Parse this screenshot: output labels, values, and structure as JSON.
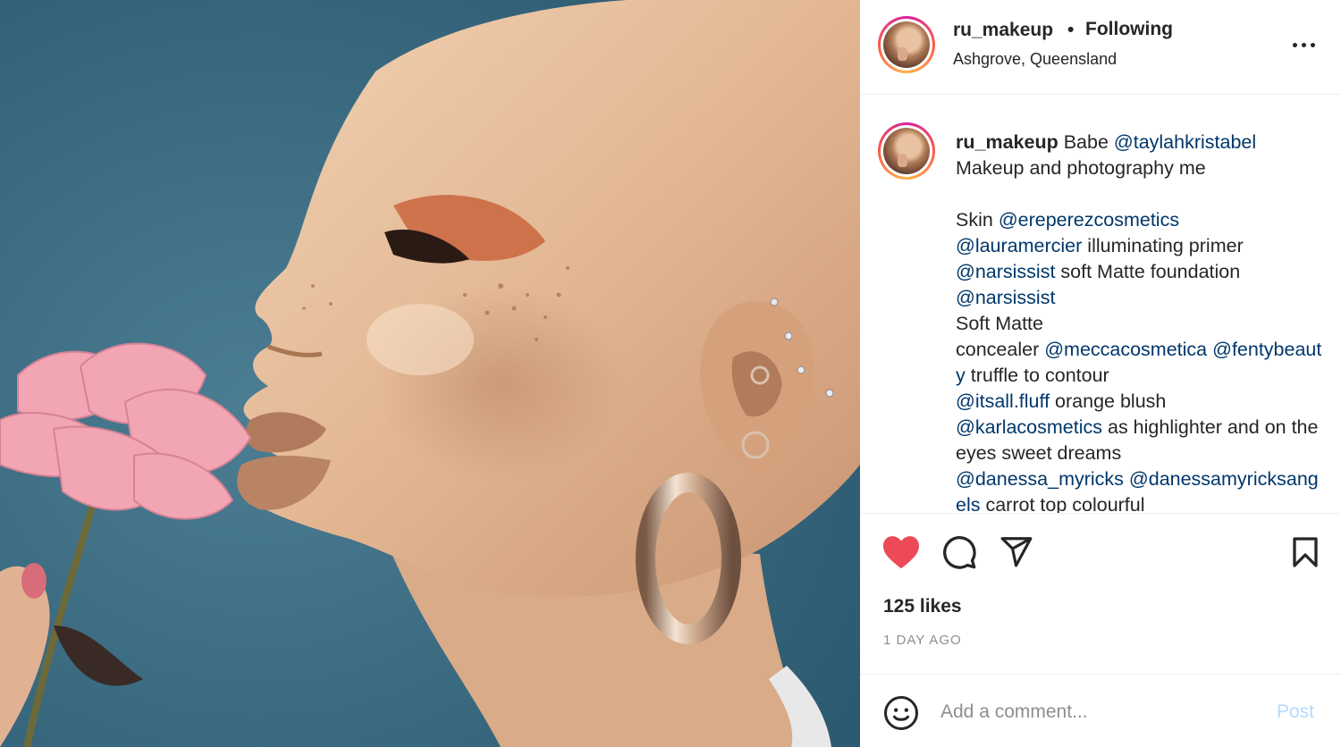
{
  "post": {
    "username": "ru_makeup",
    "separator": "•",
    "follow_status": "Following",
    "location": "Ashgrove, Queensland"
  },
  "caption": {
    "username": "ru_makeup",
    "segments": [
      {
        "t": "Babe ",
        "mention": false
      },
      {
        "t": "@taylahkristabel",
        "mention": true
      },
      {
        "t": "\nMakeup and photography me\n\nSkin ",
        "mention": false
      },
      {
        "t": "@ereperezcosmetics",
        "mention": true
      },
      {
        "t": "\n",
        "mention": false
      },
      {
        "t": "@lauramercier",
        "mention": true
      },
      {
        "t": " illuminating primer\n",
        "mention": false
      },
      {
        "t": "@narsissist",
        "mention": true
      },
      {
        "t": " soft Matte foundation\n",
        "mention": false
      },
      {
        "t": "@narsissist",
        "mention": true
      },
      {
        "t": "\nSoft Matte\nconcealer ",
        "mention": false
      },
      {
        "t": "@meccacosmetica",
        "mention": true
      },
      {
        "t": " ",
        "mention": false
      },
      {
        "t": "@fentybeauty",
        "mention": true
      },
      {
        "t": "  truffle to contour\n",
        "mention": false
      },
      {
        "t": "@itsall.fluff",
        "mention": true
      },
      {
        "t": " orange blush\n",
        "mention": false
      },
      {
        "t": "@karlacosmetics",
        "mention": true
      },
      {
        "t": " as highlighter and on the eyes sweet dreams\n",
        "mention": false
      },
      {
        "t": "@danessa_myricks",
        "mention": true
      },
      {
        "t": " ",
        "mention": false
      },
      {
        "t": "@danessamyricksangels",
        "mention": true
      },
      {
        "t": " carrot top colourful",
        "mention": false
      }
    ]
  },
  "stats": {
    "likes": "125 likes",
    "posted": "1 DAY AGO"
  },
  "comment": {
    "placeholder": "Add a comment...",
    "post_label": "Post"
  },
  "icons": {
    "like": "heart-filled-icon",
    "comment": "comment-bubble-icon",
    "share": "paper-plane-icon",
    "save": "bookmark-icon",
    "emoji": "smiley-icon",
    "more": "more-horizontal-icon"
  },
  "colors": {
    "heart": "#ed4956",
    "mention": "#00376b",
    "post_disabled": "#b3dbff",
    "muted": "#8e8e8e",
    "photo_background": "#3f6f86"
  }
}
